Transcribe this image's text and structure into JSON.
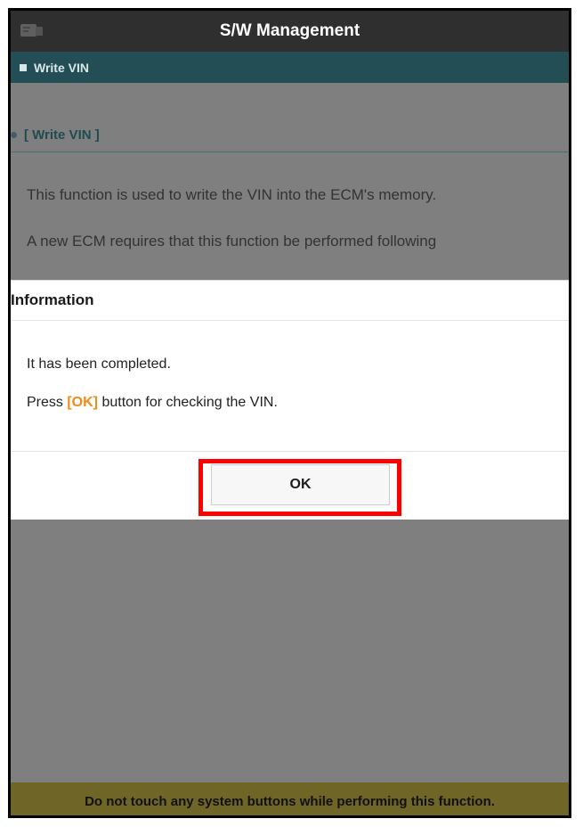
{
  "window": {
    "title": "S/W Management"
  },
  "header": {
    "label": "Write VIN"
  },
  "content": {
    "section_title": "[ Write VIN ]",
    "description_1": "This function is used to write the VIN into the ECM's memory.",
    "description_2": "A new ECM requires that this function be performed following"
  },
  "dialog": {
    "title": "Information",
    "message_1": "It has been completed.",
    "message_2_prefix": "Press ",
    "message_2_ok": "[OK]",
    "message_2_suffix": " button for checking the VIN.",
    "ok_button_label": "OK"
  },
  "footer": {
    "warning": "Do not touch any system buttons while performing this function."
  },
  "colors": {
    "titlebar": "#2f2f2f",
    "header_strip": "#244e56",
    "overlay": "#7f7f7f",
    "highlight": "#ff0000",
    "warning_bar": "#6f6527",
    "ok_text_orange": "#f28a18"
  },
  "icons": {
    "app": "app-icon",
    "warning": "warning-icon"
  }
}
